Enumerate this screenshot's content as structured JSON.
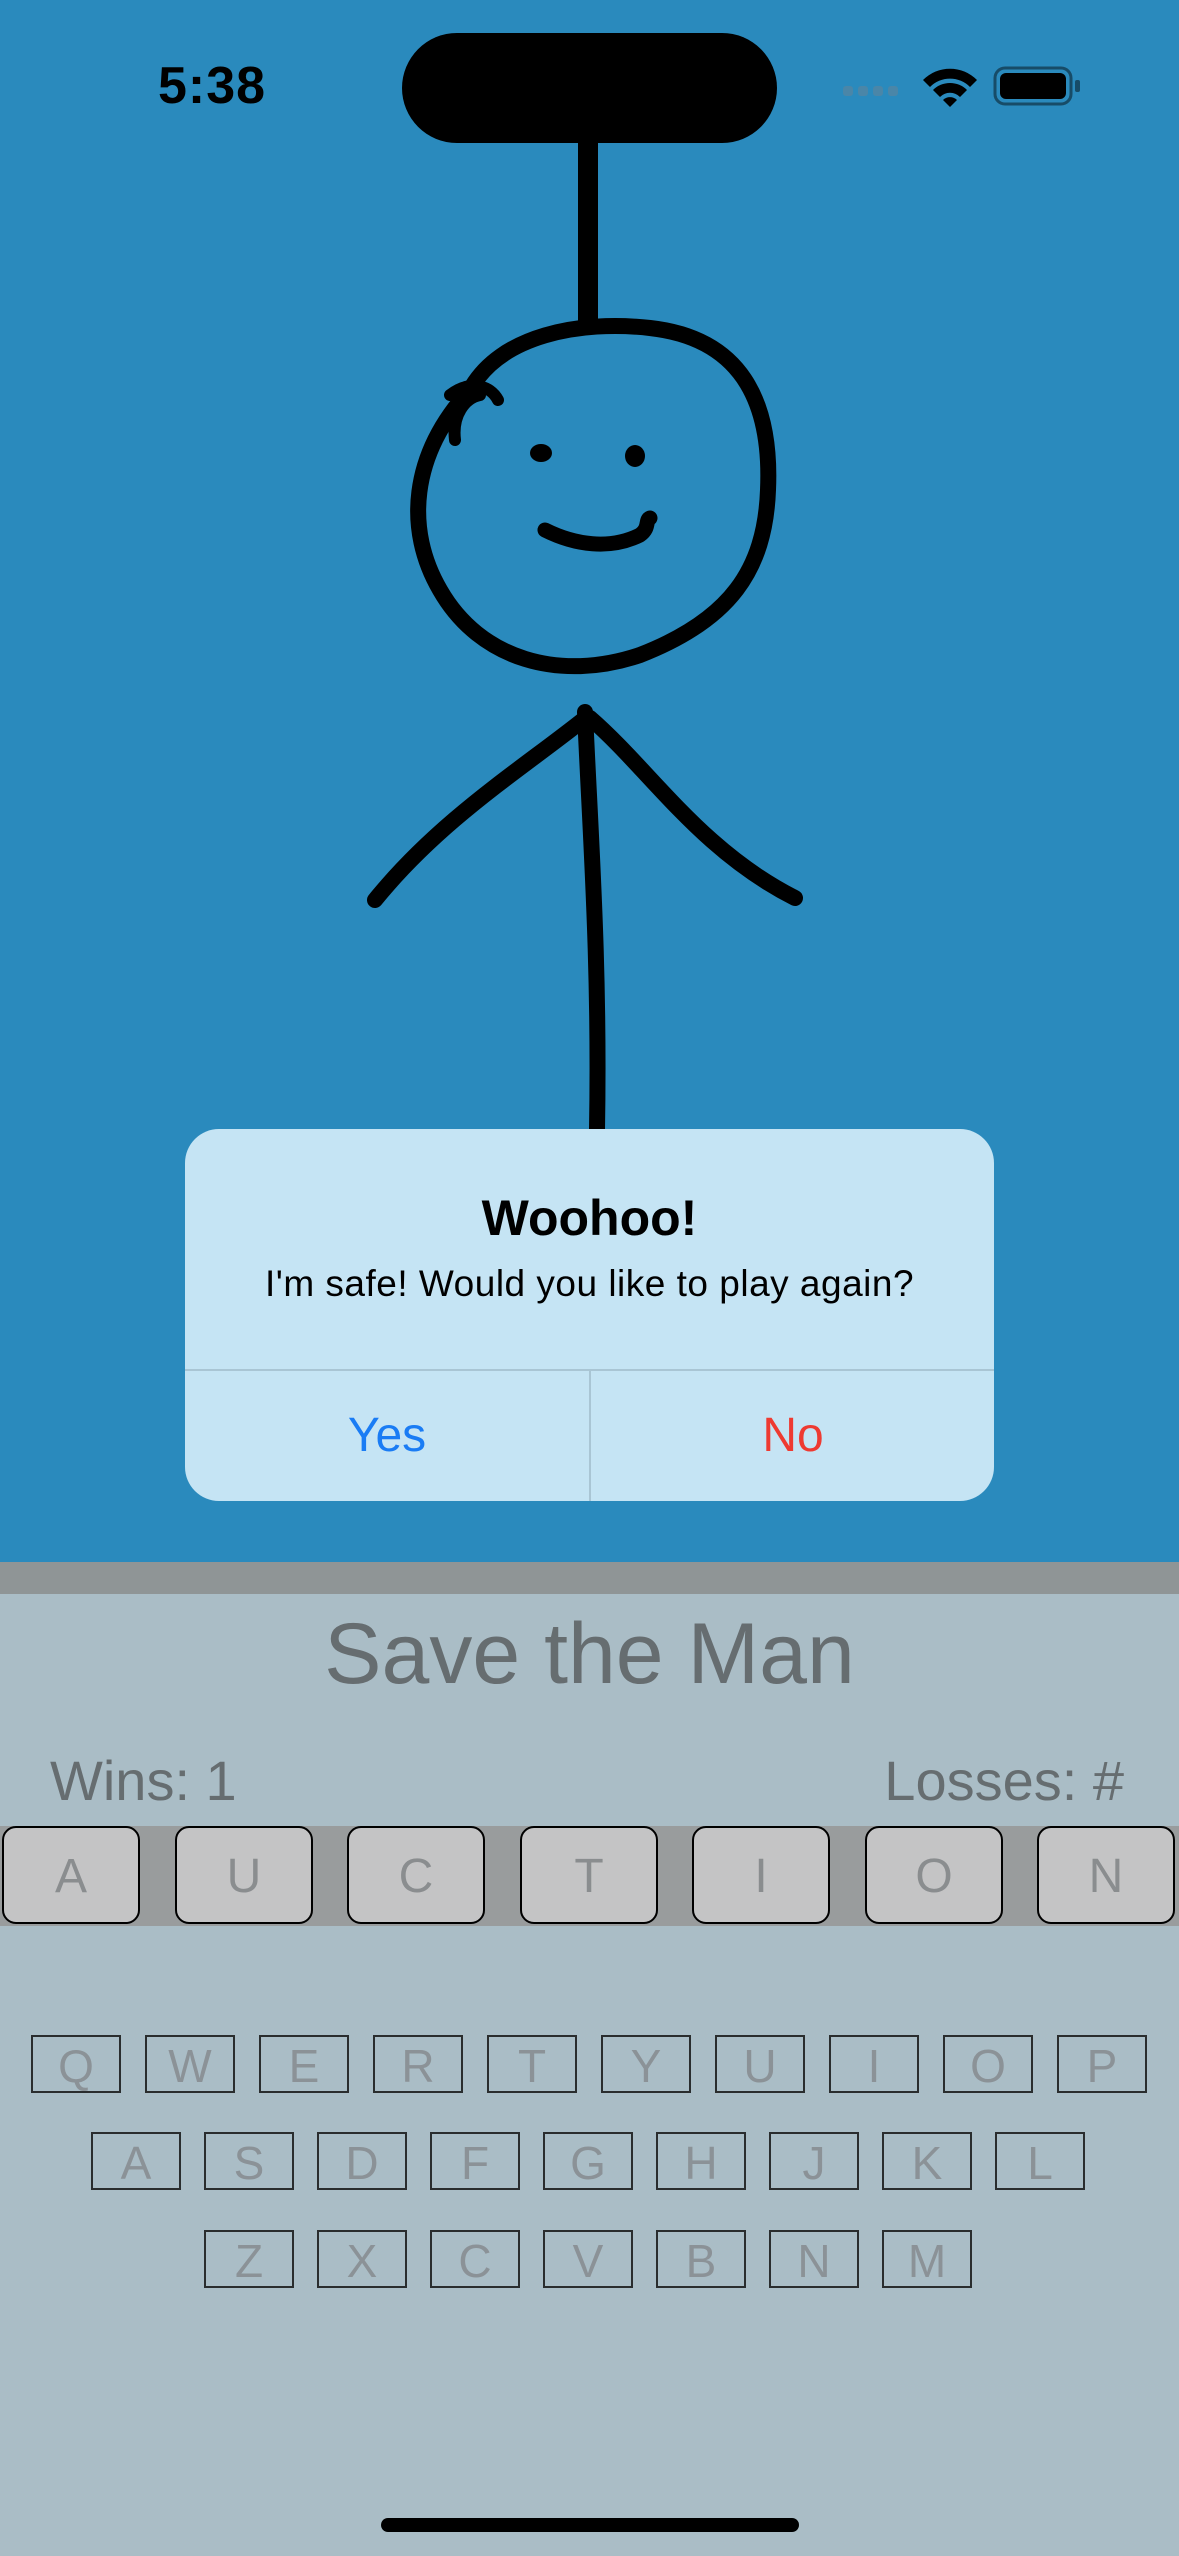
{
  "status_bar": {
    "time": "5:38"
  },
  "game": {
    "title": "Save the Man",
    "wins_label": "Wins: 1",
    "losses_label": "Losses:  #",
    "word_letters": [
      "A",
      "U",
      "C",
      "T",
      "I",
      "O",
      "N"
    ]
  },
  "keyboard": {
    "row1": [
      "Q",
      "W",
      "E",
      "R",
      "T",
      "Y",
      "U",
      "I",
      "O",
      "P"
    ],
    "row2": [
      "A",
      "S",
      "D",
      "F",
      "G",
      "H",
      "J",
      "K",
      "L"
    ],
    "row3": [
      "Z",
      "X",
      "C",
      "V",
      "B",
      "N",
      "M"
    ]
  },
  "alert": {
    "title": "Woohoo!",
    "message": "I'm safe! Would you like to play again?",
    "yes_label": "Yes",
    "no_label": "No"
  },
  "colors": {
    "sky": "#2a8abd",
    "panel": "#aabdc6",
    "alert_bg": "#c5e4f4",
    "yes": "#1a7cf4",
    "no": "#ee3a31"
  }
}
